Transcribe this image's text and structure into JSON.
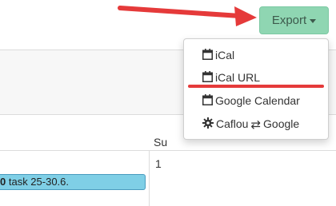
{
  "toolbar": {
    "export_label": "Export"
  },
  "dropdown": {
    "items": [
      {
        "label": "iCal",
        "icon": "calendar-icon"
      },
      {
        "label": "iCal URL",
        "icon": "calendar-icon"
      },
      {
        "label": "Google Calendar",
        "icon": "calendar-icon"
      },
      {
        "label_left": "Caflou",
        "label_right": "Google",
        "icon": "gear-icon",
        "middle_icon": "swap-arrows-icon"
      }
    ]
  },
  "calendar": {
    "column_header": "Su",
    "day_number": "1",
    "event": {
      "bold_prefix": "0",
      "text": " task 25-30.6."
    }
  },
  "annotation": {
    "arrow_color": "#e53a3a",
    "underline_color": "#e53a3a"
  },
  "colors": {
    "export_button_bg": "#8fd6b2",
    "event_bg": "#7fcfe6"
  }
}
